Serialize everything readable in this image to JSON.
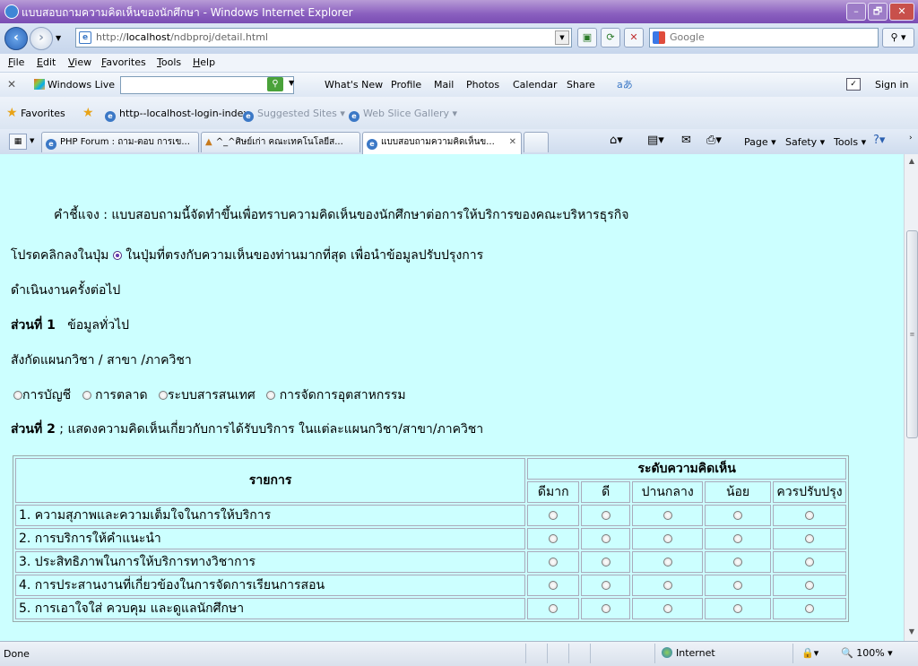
{
  "window": {
    "title": "แบบสอบถามความคิดเห็นของนักศึกษา - Windows Internet Explorer",
    "minimize": "–",
    "maximize": "🗗",
    "close": "✕"
  },
  "address": {
    "url_prefix": "http://",
    "url_host": "localhost",
    "url_path": "/ndbproj/detail.html",
    "search_placeholder": "Google"
  },
  "menu": [
    "File",
    "Edit",
    "View",
    "Favorites",
    "Tools",
    "Help"
  ],
  "windows_live": {
    "label": "Windows Live",
    "links": [
      "What's New",
      "Profile",
      "Mail",
      "Photos",
      "Calendar",
      "Share"
    ],
    "sign_in": "Sign in"
  },
  "favorites": {
    "label": "Favorites",
    "items": [
      "http--localhost-login-index",
      "Suggested Sites ▾",
      "Web Slice Gallery ▾"
    ]
  },
  "tabs": [
    "PHP Forum : ถาม-ตอบ การเข...",
    "^_^ศิษย์เก่า คณะเทคโนโลยีส...",
    "แบบสอบถามความคิดเห็นข..."
  ],
  "commands": [
    "Page ▾",
    "Safety ▾",
    "Tools ▾"
  ],
  "content": {
    "intro": "คำชี้แจง : แบบสอบถามนี้จัดทำขึ้นเพื่อทราบความคิดเห็นของนักศึกษาต่อการให้บริการของคณะบริหารธุรกิจ",
    "instruction_before": "โปรดคลิกลงในปุ่ม",
    "instruction_after": "ในปุ่มที่ตรงกับความเห็นของท่านมากที่สุด   เพื่อนำข้อมูลปรับปรุงการ",
    "instruction_cont": "ดำเนินงานครั้งต่อไป",
    "section1_title": "ส่วนที่ 1",
    "section1_text": "ข้อมูลทั่วไป",
    "affiliation_label": "สังกัดแผนกวิชา / สาขา  /ภาควิชา",
    "departments": [
      "การบัญชี",
      "การตลาด",
      "ระบบสารสนเทศ",
      "การจัดการอุตสาหกรรม"
    ],
    "section2_title": "ส่วนที่ 2",
    "section2_text": ";    แสดงความคิดเห็นเกี่ยวกับการได้รับบริการ  ในแต่ละแผนกวิชา/สาขา/ภาควิชา"
  },
  "survey": {
    "item_header": "รายการ",
    "level_header": "ระดับความคิดเห็น",
    "levels": [
      "ดีมาก",
      "ดี",
      "ปานกลาง",
      "น้อย",
      "ควรปรับปรุง"
    ],
    "items": [
      "1. ความสุภาพและความเต็มใจในการให้บริการ",
      "2. การบริการให้คำแนะนำ",
      "3. ประสิทธิภาพในการให้บริการทางวิชาการ",
      "4. การประสานงานที่เกี่ยวข้องในการจัดการเรียนการสอน",
      "5. การเอาใจใส่ ควบคุม และดูแลนักศึกษา"
    ]
  },
  "status": {
    "left": "Done",
    "zone": "Internet",
    "zoom": "100%"
  }
}
